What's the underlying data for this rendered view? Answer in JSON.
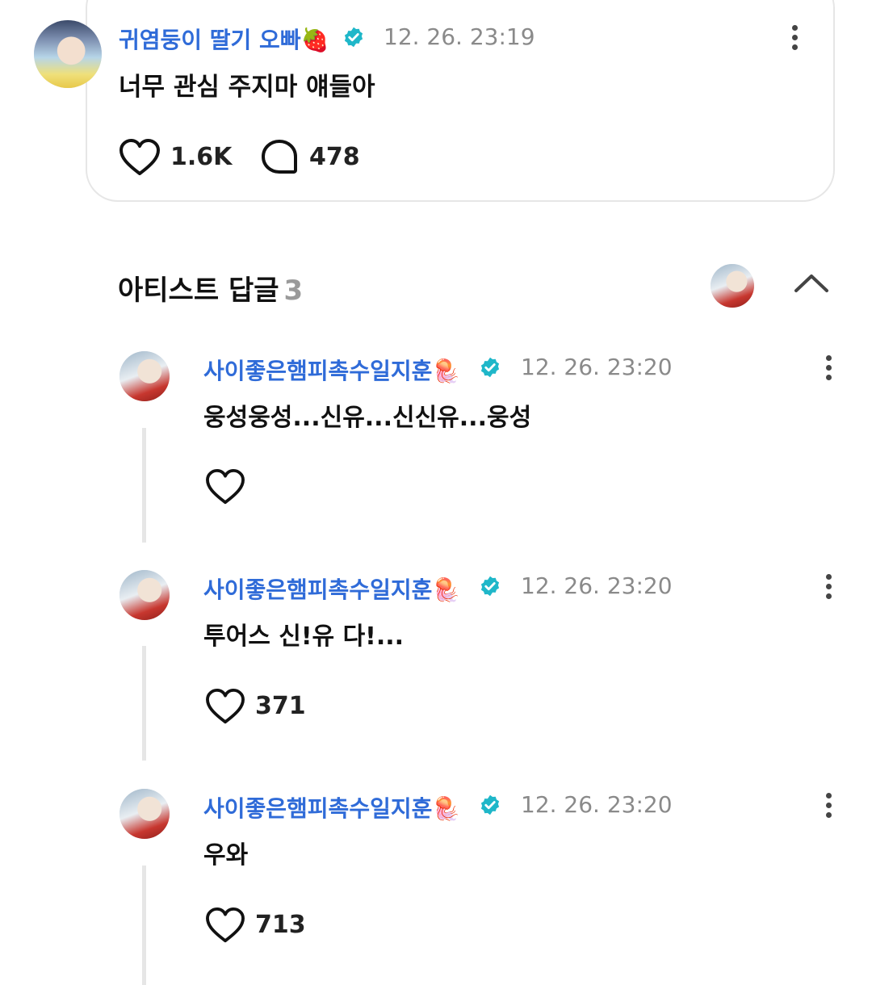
{
  "post": {
    "author": "귀염둥이 딸기 오빠🍓",
    "timestamp": "12. 26. 23:19",
    "text": "너무 관심 주지마 얘들아",
    "likes": "1.6K",
    "comments": "478"
  },
  "artist_replies": {
    "title": "아티스트 답글",
    "count": "3",
    "replies": [
      {
        "author": "사이좋은햄피촉수일지훈🪼",
        "timestamp": "12. 26. 23:20",
        "text": "웅성웅성...신유...신신유...웅성",
        "likes": ""
      },
      {
        "author": "사이좋은햄피촉수일지훈🪼",
        "timestamp": "12. 26. 23:20",
        "text": "투어스 신!유 다!...",
        "likes": "371"
      },
      {
        "author": "사이좋은햄피촉수일지훈🪼",
        "timestamp": "12. 26. 23:20",
        "text": "우와",
        "likes": "713"
      }
    ]
  },
  "icons": {
    "verified": "verified-badge-icon",
    "like": "heart-icon",
    "comment": "speech-bubble-icon",
    "more": "kebab-menu-icon",
    "collapse": "chevron-up-icon"
  },
  "colors": {
    "name": "#2f6bd8",
    "verified": "#1fb7c9",
    "timestamp": "#8a8a8a",
    "border": "#e6e6e6"
  }
}
